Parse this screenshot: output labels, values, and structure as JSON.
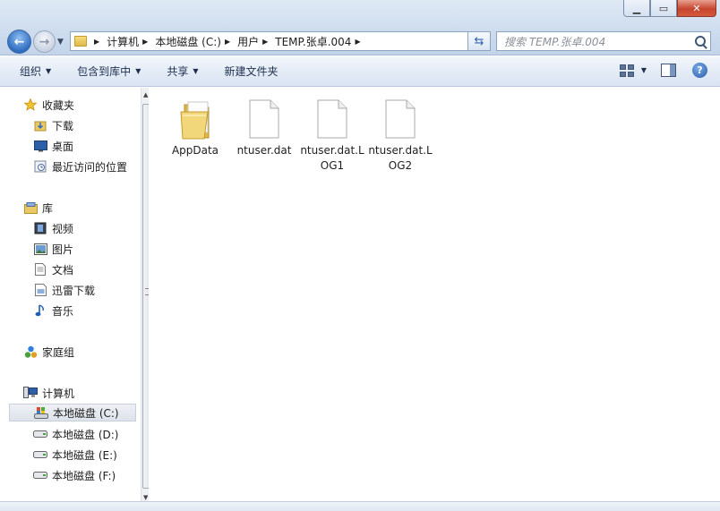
{
  "address": {
    "crumbs": [
      "计算机",
      "本地磁盘 (C:)",
      "用户",
      "TEMP.张卓.004"
    ]
  },
  "search": {
    "placeholder": "搜索 TEMP.张卓.004"
  },
  "toolbar": {
    "organize": "组织",
    "include_library": "包含到库中",
    "share": "共享",
    "new_folder": "新建文件夹"
  },
  "sidebar": {
    "favorites": "收藏夹",
    "downloads": "下载",
    "desktop": "桌面",
    "recent": "最近访问的位置",
    "libraries": "库",
    "videos": "视频",
    "pictures": "图片",
    "documents": "文档",
    "xunlei": "迅雷下载",
    "music": "音乐",
    "homegroup": "家庭组",
    "computer": "计算机",
    "drive_c": "本地磁盘 (C:)",
    "drive_d": "本地磁盘 (D:)",
    "drive_e": "本地磁盘 (E:)",
    "drive_f": "本地磁盘 (F:)"
  },
  "files": [
    {
      "name": "AppData",
      "icon": "folder-icon"
    },
    {
      "name": "ntuser.dat",
      "icon": "file-icon"
    },
    {
      "name": "ntuser.dat.LOG1",
      "icon": "file-icon"
    },
    {
      "name": "ntuser.dat.LOG2",
      "icon": "file-icon"
    }
  ],
  "colors": {
    "accent": "#2f6cc0",
    "folder": "#e8c55e"
  }
}
